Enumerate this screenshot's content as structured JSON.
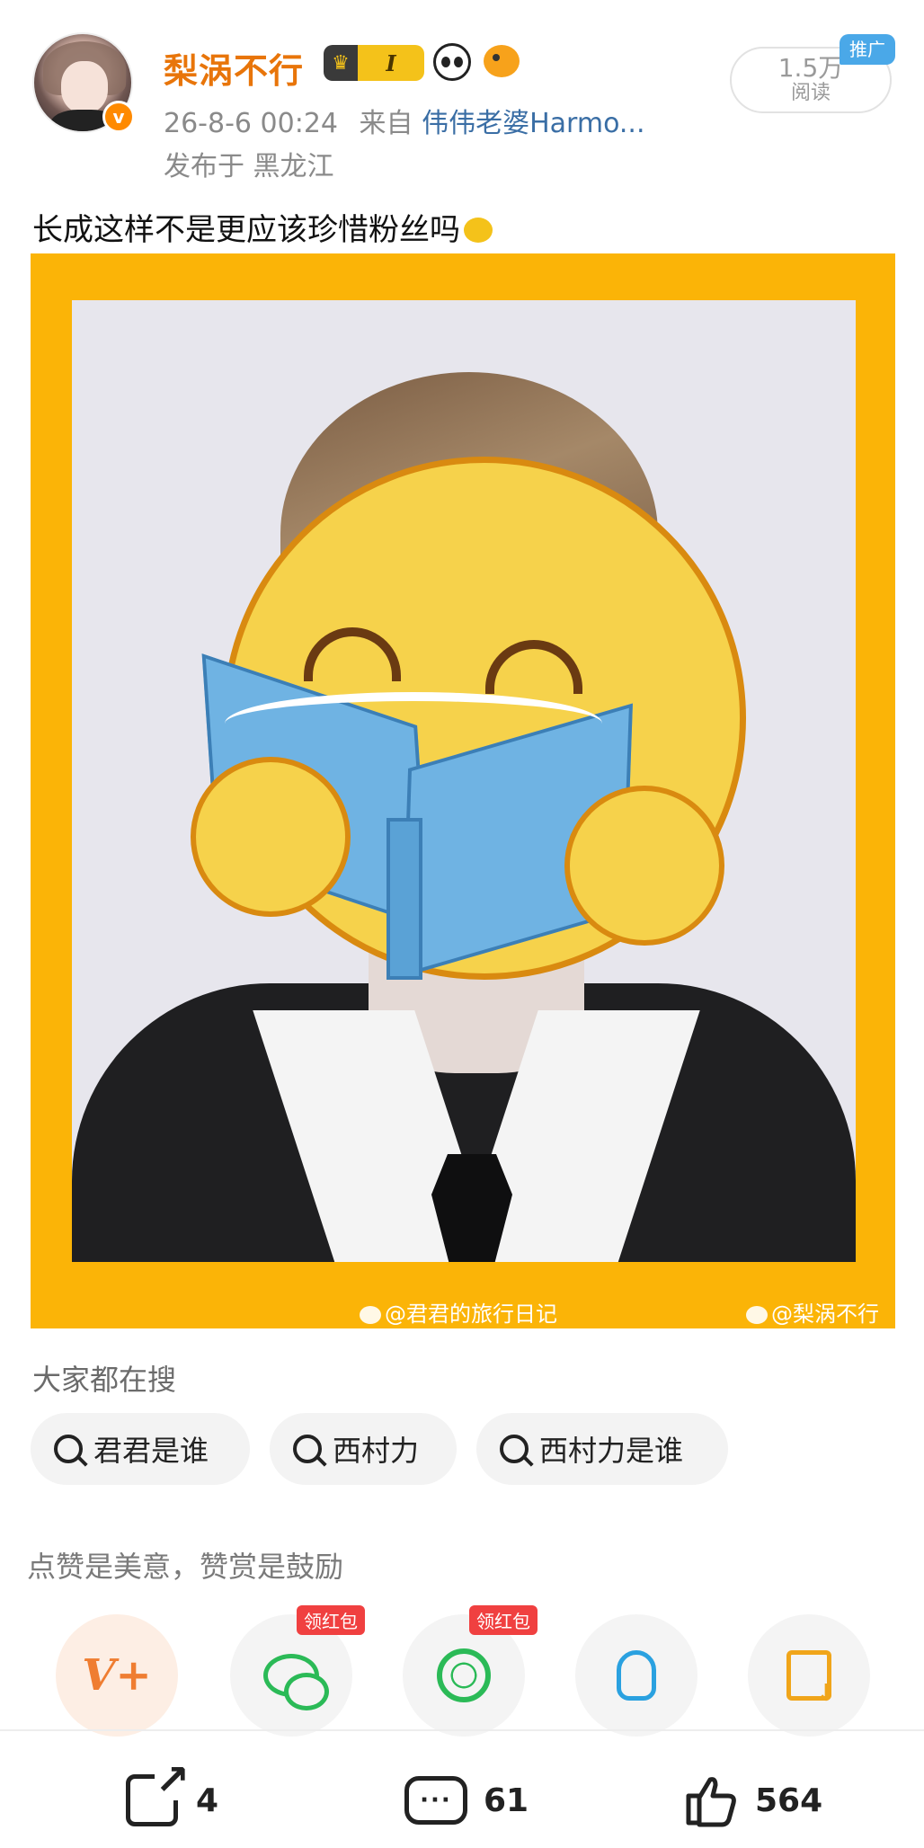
{
  "post": {
    "username": "梨涡不行",
    "level_badge": "I",
    "timestamp": "26-8-6 00:24",
    "source_prefix": "来自",
    "source": "伟伟老婆Harmo...",
    "location": "发布于 黑龙江",
    "reads_count": "1.5万",
    "reads_label": "阅读",
    "promo_tag": "推广",
    "text": "长成这样不是更应该珍惜粉丝吗",
    "image_watermarks": [
      "@君君的旅行日记",
      "@梨涡不行"
    ]
  },
  "search": {
    "title": "大家都在搜",
    "chips": [
      "君君是谁",
      "西村力",
      "西村力是谁"
    ]
  },
  "reward": {
    "text": "点赞是美意，赞赏是鼓励",
    "share_targets": [
      {
        "name": "v-plus",
        "tag": ""
      },
      {
        "name": "wechat-icon",
        "tag": "领红包"
      },
      {
        "name": "moments-icon",
        "tag": "领红包"
      },
      {
        "name": "qq-icon",
        "tag": ""
      },
      {
        "name": "save-image-icon",
        "tag": ""
      }
    ],
    "v_label": "V+"
  },
  "bottom_bar": {
    "share_count": "4",
    "comment_count": "61",
    "like_count": "564"
  },
  "colors": {
    "username": "#e8750a",
    "source_link": "#3a6ea5",
    "photo_frame": "#fbb407",
    "chip_bg": "#f3f3f3",
    "red_tag": "#f04040"
  }
}
